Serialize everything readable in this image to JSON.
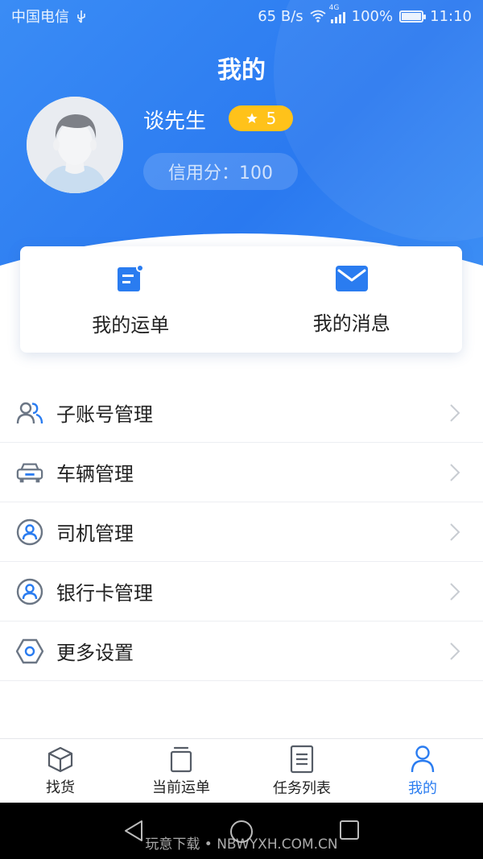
{
  "status_bar": {
    "carrier": "中国电信",
    "speed": "65 B/s",
    "network": "4G",
    "battery": "100%",
    "time": "11:10"
  },
  "header": {
    "title": "我的",
    "username": "谈先生",
    "star_count": "5",
    "credit": "信用分：100"
  },
  "card": {
    "items": [
      {
        "label": "我的运单",
        "icon": "waybill-icon"
      },
      {
        "label": "我的消息",
        "icon": "mail-icon"
      }
    ]
  },
  "menu": {
    "items": [
      {
        "label": "子账号管理",
        "icon": "users-icon"
      },
      {
        "label": "车辆管理",
        "icon": "car-icon"
      },
      {
        "label": "司机管理",
        "icon": "driver-icon"
      },
      {
        "label": "银行卡管理",
        "icon": "bank-card-icon"
      },
      {
        "label": "更多设置",
        "icon": "settings-hexagon-icon"
      }
    ]
  },
  "tabbar": {
    "items": [
      {
        "label": "找货",
        "icon": "box-icon"
      },
      {
        "label": "当前运单",
        "icon": "clipboard-icon"
      },
      {
        "label": "任务列表",
        "icon": "list-icon"
      },
      {
        "label": "我的",
        "icon": "person-icon",
        "active": true
      }
    ]
  },
  "watermark": "玩意下载 • NBWYXH.COM.CN",
  "colors": {
    "primary": "#2a7cf0",
    "header_blue": "#3a8cf5",
    "badge_yellow": "#ffc21a",
    "icon_gray": "#6b7685"
  }
}
